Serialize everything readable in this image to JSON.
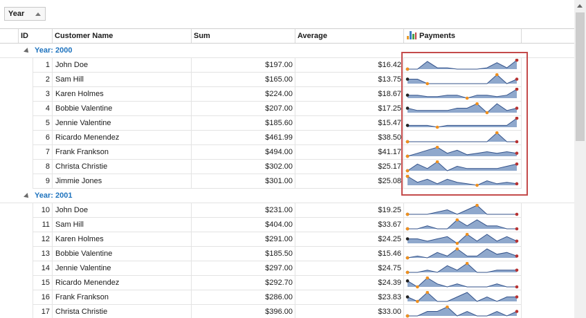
{
  "group_panel": {
    "chip_label": "Year"
  },
  "columns": {
    "id": "ID",
    "name": "Customer Name",
    "sum": "Sum",
    "average": "Average",
    "payments": "Payments"
  },
  "colors": {
    "accent": "#1e73be",
    "area": "#8fa8cc",
    "line": "#33528a",
    "min_marker": "#f0901e",
    "end_marker": "#b83232",
    "start_marker": "#222222"
  },
  "groups": [
    {
      "label": "Year: 2000",
      "rows": [
        {
          "id": "1",
          "name": "John Doe",
          "sum": "$197.00",
          "avg": "$16.42",
          "spark": [
            0,
            0,
            6,
            1,
            1,
            0,
            0,
            0,
            1,
            5,
            1,
            7
          ]
        },
        {
          "id": "2",
          "name": "Sam Hill",
          "sum": "$165.00",
          "avg": "$13.75",
          "spark": [
            3,
            3,
            2,
            2,
            2,
            2,
            2,
            2,
            2,
            4,
            2,
            3
          ]
        },
        {
          "id": "3",
          "name": "Karen Holmes",
          "sum": "$224.00",
          "avg": "$18.67",
          "spark": [
            3,
            3,
            2,
            2,
            3,
            3,
            1,
            3,
            3,
            2,
            3,
            7
          ]
        },
        {
          "id": "4",
          "name": "Bobbie Valentine",
          "sum": "$207.00",
          "avg": "$17.25",
          "spark": [
            3,
            2,
            2,
            2,
            2,
            3,
            3,
            5,
            1,
            5,
            2,
            3
          ]
        },
        {
          "id": "5",
          "name": "Jennie Valentine",
          "sum": "$185.60",
          "avg": "$15.47",
          "spark": [
            2,
            2,
            2,
            1,
            2,
            2,
            2,
            2,
            2,
            2,
            2,
            6
          ]
        },
        {
          "id": "6",
          "name": "Ricardo Menendez",
          "sum": "$461.99",
          "avg": "$38.50",
          "spark": [
            2,
            2,
            2,
            2,
            2,
            2,
            2,
            2,
            2,
            6,
            2,
            2
          ]
        },
        {
          "id": "7",
          "name": "Frank Frankson",
          "sum": "$494.00",
          "avg": "$41.17",
          "spark": [
            1,
            3,
            5,
            7,
            3,
            5,
            2,
            3,
            4,
            3,
            4,
            3
          ]
        },
        {
          "id": "8",
          "name": "Christa Christie",
          "sum": "$302.00",
          "avg": "$25.17",
          "spark": [
            1,
            4,
            2,
            5,
            1,
            3,
            2,
            2,
            2,
            2,
            3,
            4
          ]
        },
        {
          "id": "9",
          "name": "Jimmie Jones",
          "sum": "$301.00",
          "avg": "$25.08",
          "spark": [
            7,
            3,
            5,
            2,
            5,
            3,
            2,
            1,
            4,
            2,
            3,
            2
          ]
        }
      ]
    },
    {
      "label": "Year: 2001",
      "rows": [
        {
          "id": "10",
          "name": "John Doe",
          "sum": "$231.00",
          "avg": "$19.25",
          "spark": [
            2,
            2,
            2,
            3,
            4,
            2,
            4,
            6,
            2,
            2,
            2,
            2
          ]
        },
        {
          "id": "11",
          "name": "Sam Hill",
          "sum": "$404.00",
          "avg": "$33.67",
          "spark": [
            2,
            2,
            3,
            2,
            2,
            5,
            3,
            5,
            3,
            3,
            2,
            2
          ]
        },
        {
          "id": "12",
          "name": "Karen Holmes",
          "sum": "$291.00",
          "avg": "$24.25",
          "spark": [
            3,
            3,
            2,
            3,
            4,
            1,
            5,
            2,
            5,
            2,
            4,
            2
          ]
        },
        {
          "id": "13",
          "name": "Bobbie Valentine",
          "sum": "$185.50",
          "avg": "$15.46",
          "spark": [
            1,
            2,
            1,
            4,
            2,
            6,
            2,
            2,
            6,
            3,
            4,
            2
          ]
        },
        {
          "id": "14",
          "name": "Jennie Valentine",
          "sum": "$297.00",
          "avg": "$24.75",
          "spark": [
            2,
            2,
            3,
            2,
            5,
            3,
            6,
            2,
            2,
            3,
            3,
            3
          ]
        },
        {
          "id": "15",
          "name": "Ricardo Menendez",
          "sum": "$292.70",
          "avg": "$24.39",
          "spark": [
            4,
            2,
            5,
            3,
            2,
            3,
            2,
            2,
            2,
            3,
            2,
            2
          ]
        },
        {
          "id": "16",
          "name": "Frank Frankson",
          "sum": "$286.00",
          "avg": "$23.83",
          "spark": [
            3,
            2,
            4,
            2,
            2,
            3,
            4,
            2,
            3,
            2,
            3,
            3
          ]
        },
        {
          "id": "17",
          "name": "Christa Christie",
          "sum": "$396.00",
          "avg": "$33.00",
          "spark": [
            2,
            2,
            3,
            3,
            4,
            2,
            3,
            2,
            2,
            3,
            2,
            3
          ]
        }
      ]
    }
  ]
}
